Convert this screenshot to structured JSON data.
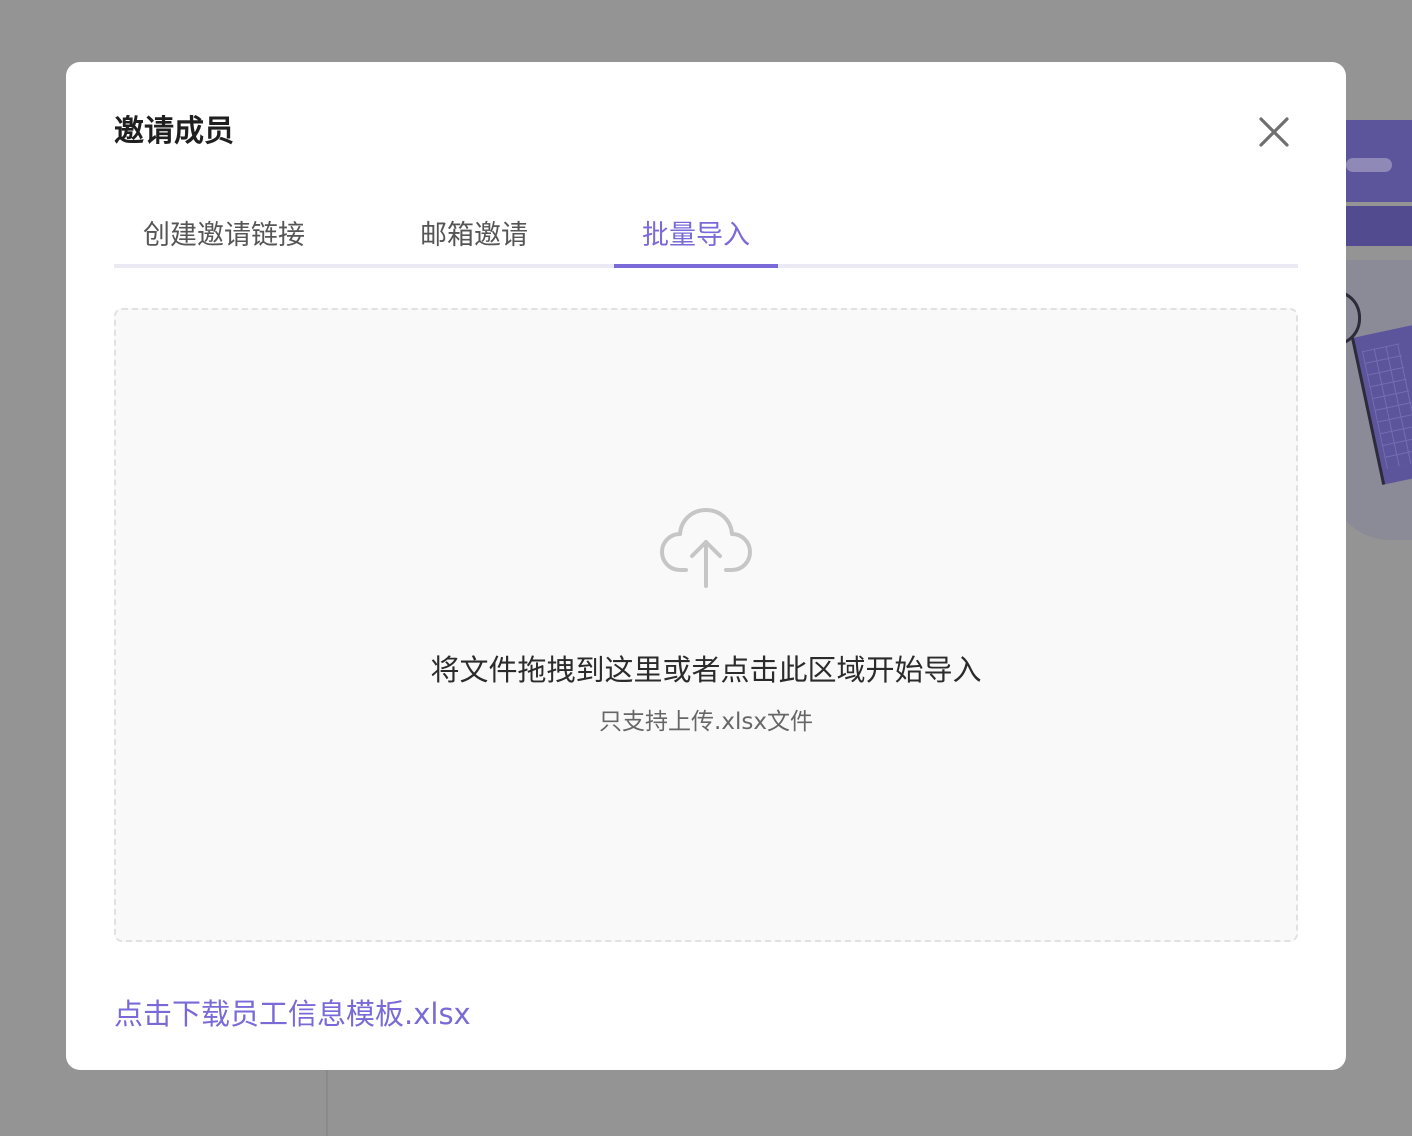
{
  "modal": {
    "title": "邀请成员",
    "tabs": [
      {
        "label": "创建邀请链接",
        "active": false
      },
      {
        "label": "邮箱邀请",
        "active": false
      },
      {
        "label": "批量导入",
        "active": true
      }
    ],
    "dropzone": {
      "icon": "cloud-upload-icon",
      "primary_text": "将文件拖拽到这里或者点击此区域开始导入",
      "secondary_text": "只支持上传.xlsx文件"
    },
    "download_link": "点击下载员工信息模板.xlsx",
    "close_icon": "close-icon"
  },
  "colors": {
    "accent": "#7a6ad8",
    "overlay": "#949494",
    "tab_track": "#ebe9f4",
    "dropzone_bg": "#f9f9f9"
  }
}
